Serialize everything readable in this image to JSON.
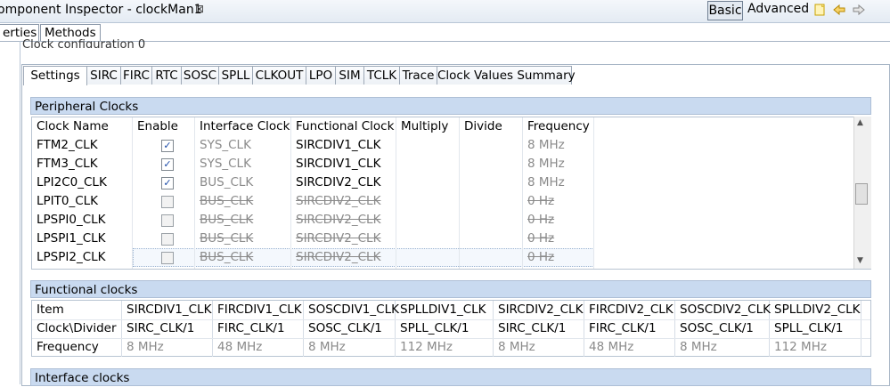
{
  "titlebar": {
    "title": "omponent Inspector - clockMan1",
    "close": "⊠",
    "basic": "Basic",
    "advanced": "Advanced"
  },
  "subtabs": [
    "erties",
    "Methods"
  ],
  "group_label": "Clock configuration 0",
  "config_tabs": [
    "Settings",
    "SIRC",
    "FIRC",
    "RTC",
    "SOSC",
    "SPLL",
    "CLKOUT",
    "LPO",
    "SIM",
    "TCLK",
    "Trace",
    "Clock Values Summary"
  ],
  "peripheral": {
    "title": "Peripheral Clocks",
    "columns": [
      "Clock Name",
      "Enable",
      "Interface Clock",
      "Functional Clock",
      "Multiply",
      "Divide",
      "Frequency"
    ],
    "rows": [
      {
        "name": "FTM2_CLK",
        "enabled": true,
        "iface": "SYS_CLK",
        "func": "SIRCDIV1_CLK",
        "mult": "",
        "div": "",
        "freq": "8 MHz"
      },
      {
        "name": "FTM3_CLK",
        "enabled": true,
        "iface": "SYS_CLK",
        "func": "SIRCDIV1_CLK",
        "mult": "",
        "div": "",
        "freq": "8 MHz"
      },
      {
        "name": "LPI2C0_CLK",
        "enabled": true,
        "iface": "BUS_CLK",
        "func": "SIRCDIV2_CLK",
        "mult": "",
        "div": "",
        "freq": "8 MHz"
      },
      {
        "name": "LPIT0_CLK",
        "enabled": false,
        "iface": "BUS_CLK",
        "func": "SIRCDIV2_CLK",
        "mult": "",
        "div": "",
        "freq": "0 Hz"
      },
      {
        "name": "LPSPI0_CLK",
        "enabled": false,
        "iface": "BUS_CLK",
        "func": "SIRCDIV2_CLK",
        "mult": "",
        "div": "",
        "freq": "0 Hz"
      },
      {
        "name": "LPSPI1_CLK",
        "enabled": false,
        "iface": "BUS_CLK",
        "func": "SIRCDIV2_CLK",
        "mult": "",
        "div": "",
        "freq": "0 Hz"
      },
      {
        "name": "LPSPI2_CLK",
        "enabled": false,
        "iface": "BUS_CLK",
        "func": "SIRCDIV2_CLK",
        "mult": "",
        "div": "",
        "freq": "0 Hz"
      }
    ]
  },
  "functional": {
    "title": "Functional clocks",
    "header": [
      "Item",
      "SIRCDIV1_CLK",
      "FIRCDIV1_CLK",
      "SOSCDIV1_CLK",
      "SPLLDIV1_CLK",
      "SIRCDIV2_CLK",
      "FIRCDIV2_CLK",
      "SOSCDIV2_CLK",
      "SPLLDIV2_CLK"
    ],
    "rows": [
      [
        "Clock\\Divider",
        "SIRC_CLK/1",
        "FIRC_CLK/1",
        "SOSC_CLK/1",
        "SPLL_CLK/1",
        "SIRC_CLK/1",
        "FIRC_CLK/1",
        "SOSC_CLK/1",
        "SPLL_CLK/1"
      ],
      [
        "Frequency",
        "8 MHz",
        "48 MHz",
        "8 MHz",
        "112 MHz",
        "8 MHz",
        "48 MHz",
        "8 MHz",
        "112 MHz"
      ]
    ]
  },
  "interface": {
    "title": "Interface clocks"
  },
  "icons": [
    "note-icon",
    "arrow-left-icon",
    "arrow-right-icon",
    "checkbox-check-icon",
    "scroll-up-icon",
    "scroll-down-icon"
  ]
}
